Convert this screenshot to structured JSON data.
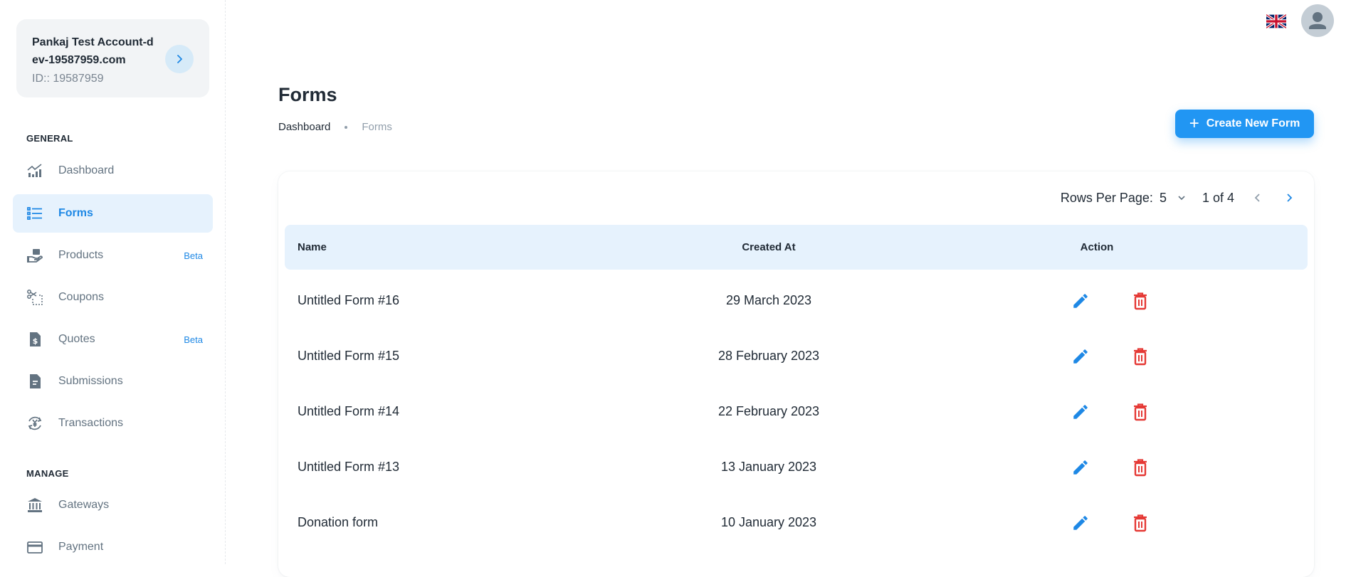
{
  "account": {
    "name": "Pankaj Test Account-dev-19587959.com",
    "id_text": "ID:: 19587959"
  },
  "sidebar": {
    "general_title": "GENERAL",
    "manage_title": "MANAGE",
    "items": [
      {
        "label": "Dashboard",
        "icon": "analytics-icon"
      },
      {
        "label": "Forms",
        "icon": "list-icon",
        "active": true
      },
      {
        "label": "Products",
        "icon": "product-hand-icon",
        "badge": "Beta"
      },
      {
        "label": "Coupons",
        "icon": "coupon-scissors-icon"
      },
      {
        "label": "Quotes",
        "icon": "invoice-dollar-icon",
        "badge": "Beta"
      },
      {
        "label": "Submissions",
        "icon": "document-icon"
      },
      {
        "label": "Transactions",
        "icon": "currency-exchange-icon"
      },
      {
        "label": "Gateways",
        "icon": "bank-icon"
      },
      {
        "label": "Payment",
        "icon": "credit-card-icon"
      }
    ]
  },
  "header": {
    "language": "uk-flag-icon",
    "avatar": "user-avatar-icon"
  },
  "page": {
    "title": "Forms",
    "breadcrumb": [
      "Dashboard",
      "Forms"
    ],
    "create_button": "Create New Form"
  },
  "pagination": {
    "rows_label": "Rows Per Page:",
    "rows_value": "5",
    "range": "1 of 4"
  },
  "table": {
    "columns": [
      "Name",
      "Created At",
      "Action"
    ],
    "rows": [
      {
        "name": "Untitled Form #16",
        "created": "29 March 2023"
      },
      {
        "name": "Untitled Form #15",
        "created": "28 February 2023"
      },
      {
        "name": "Untitled Form #14",
        "created": "22 February 2023"
      },
      {
        "name": "Untitled Form #13",
        "created": "13 January 2023"
      },
      {
        "name": "Donation form",
        "created": "10 January 2023"
      }
    ]
  },
  "colors": {
    "accent": "#2196f3",
    "active_bg": "#e6f2fd",
    "delete": "#e53935",
    "muted": "#637381"
  }
}
